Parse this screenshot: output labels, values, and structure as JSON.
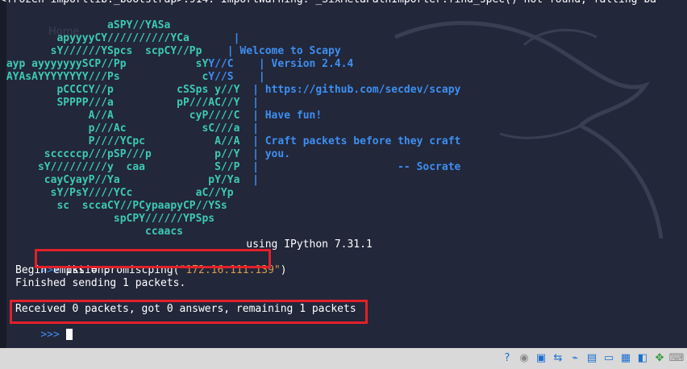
{
  "terminal": {
    "top_line": "<frozen importlib._bootstrap>:914: ImportWarning: _SixMetaPathImporter.find_spec() not found; falling ba",
    "background_ghost_text": "Home",
    "banner": [
      {
        "art": "                 aSPY//YASa       ",
        "bar": "",
        "info": ""
      },
      {
        "art": "         apyyyyCY//////////YCa    ",
        "bar": "   |",
        "info": ""
      },
      {
        "art": "        sY//////YSpcs  scpCY//Pp ",
        "bar": "   |",
        "info": " Welcome to Scapy"
      },
      {
        "art": " ayp ayyyyyyySCP//Pp           sY",
        "bar": "Y//C    |",
        "info": " Version 2.4.4"
      },
      {
        "art": " AYAsAYYYYYYYY///Ps             c",
        "bar": "Y//S    |",
        "info": ""
      },
      {
        "art": "         pCCCCY//p          cSSps y//Y",
        "bar": "  |",
        "info": " https://github.com/secdev/scapy"
      },
      {
        "art": "         SPPPP///a          pP///AC//Y",
        "bar": "  |",
        "info": ""
      },
      {
        "art": "              A//A            cyP////C",
        "bar": "  |",
        "info": " Have fun!"
      },
      {
        "art": "              p///Ac            sC///a",
        "bar": "  |",
        "info": ""
      },
      {
        "art": "              P////YCpc           A//A",
        "bar": "  |",
        "info": " Craft packets before they craft"
      },
      {
        "art": "       scccccp///pSP///p          p//Y",
        "bar": "  |",
        "info": " you."
      },
      {
        "art": "      sY/////////y  caa           S//P",
        "bar": "  |",
        "info": "                      -- Socrate"
      },
      {
        "art": "       cayCyayP//Ya              pY/Ya",
        "bar": "  |",
        "info": ""
      },
      {
        "art": "        sY/PsY////YCc          aC//Yp",
        "bar": "",
        "info": ""
      },
      {
        "art": "         sc  sccaCY//PCypaapyCP//YSs",
        "bar": "",
        "info": ""
      },
      {
        "art": "                  spCPY//////YPSps",
        "bar": "",
        "info": ""
      },
      {
        "art": "                       ccaacs",
        "bar": "",
        "info": ""
      }
    ],
    "ipython_line": "                                       using IPython 7.31.1",
    "prompt_symbol": ">>>",
    "command_prefix": " pkt = promiscping(",
    "command_arg": "\"172.16.111.139\"",
    "command_suffix": ")",
    "output_1": "Begin emission:",
    "output_2": "Finished sending 1 packets.",
    "output_3": "Received 0 packets, got 0 answers, remaining 1 packets"
  },
  "colors": {
    "art": "#3ec9b4",
    "info": "#3e8ff0",
    "string": "#d89a4d",
    "highlight": "#e2202a"
  },
  "statusbar": {
    "icons": [
      "help-icon",
      "optical-disc-icon",
      "floppy-disk-icon",
      "network-icon",
      "usb-icon",
      "shared-folder-icon",
      "display-icon",
      "recording-icon",
      "vm-window-icon",
      "mouse-integration-icon",
      "keyboard-icon"
    ]
  }
}
